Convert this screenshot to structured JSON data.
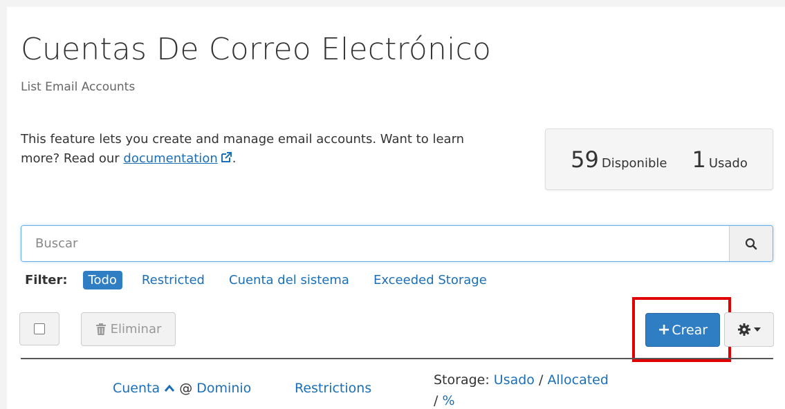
{
  "header": {
    "title": "Cuentas De Correo Electrónico",
    "subtitle": "List Email Accounts"
  },
  "description": {
    "text": "This feature lets you create and manage email accounts. Want to learn more? Read our ",
    "link": "documentation",
    "suffix": "."
  },
  "stats": {
    "available_count": "59",
    "available_label": "Disponible",
    "used_count": "1",
    "used_label": "Usado"
  },
  "search": {
    "placeholder": "Buscar",
    "value": ""
  },
  "filter": {
    "label": "Filter:",
    "options": [
      "Todo",
      "Restricted",
      "Cuenta del sistema",
      "Exceeded Storage"
    ],
    "active": "Todo"
  },
  "toolbar": {
    "delete_label": "Eliminar",
    "create_label": "Crear"
  },
  "table": {
    "col_account": "Cuenta",
    "col_at": "@",
    "col_domain": "Dominio",
    "col_restrictions": "Restrictions",
    "col_storage_label": "Storage:",
    "col_storage_used": "Usado",
    "col_storage_sep": "/",
    "col_storage_allocated": "Allocated",
    "col_storage_pct_sep": "/",
    "col_storage_pct": "%"
  },
  "colors": {
    "accent": "#2f7ec4",
    "link": "#1a6fb8",
    "highlight": "#e00000"
  },
  "icons": [
    "external-link-icon",
    "search-icon",
    "trash-icon",
    "plus-icon",
    "gear-icon",
    "caret-down-icon",
    "sort-ascending-icon"
  ]
}
